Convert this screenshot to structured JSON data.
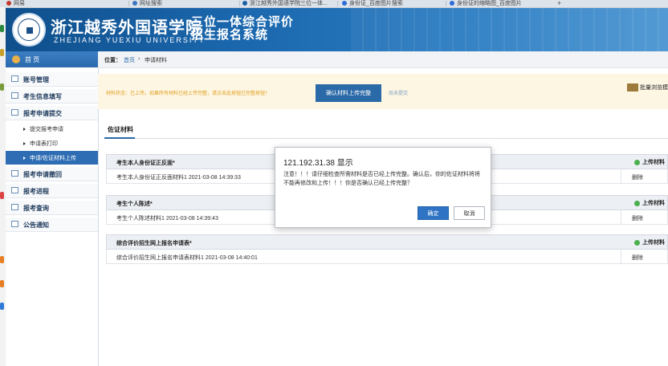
{
  "browser_tabs": [
    {
      "label": "网易",
      "color": "#c0392b"
    },
    {
      "label": "网址搜索",
      "color": "#3b78c2"
    },
    {
      "label": "浙江越秀外国语学院三位一体...",
      "color": "#1b5fa6"
    },
    {
      "label": "身份证_百度图片搜索",
      "color": "#2d6bd6"
    },
    {
      "label": "身份证的缩略图_百度图片",
      "color": "#2d6bd6"
    }
  ],
  "header": {
    "school_cn": "浙江越秀外国语学院",
    "school_en": "ZHEJIANG YUEXIU UNIVERSITY",
    "title_line1": "三位一体综合评价",
    "title_line2": "招生报名系统"
  },
  "sidebar": {
    "home": "首 页",
    "items": [
      {
        "label": "账号管理"
      },
      {
        "label": "考生信息填写"
      },
      {
        "label": "报考申请提交"
      }
    ],
    "sub_items": [
      {
        "label": "提交报考申请"
      },
      {
        "label": "申请表打印"
      },
      {
        "label": "申请/佐证材料上传",
        "active": true
      }
    ],
    "items2": [
      {
        "label": "报考申请撤回"
      },
      {
        "label": "报考进程"
      },
      {
        "label": "报考查询"
      },
      {
        "label": "公告通知"
      }
    ]
  },
  "breadcrumb": {
    "prefix": "位置：",
    "home": "首页",
    "sep": "›",
    "current": "申请材料"
  },
  "status": {
    "text": "材料状态：已上传。如果所有材料已经上传完整，请点击此按钮已完整按钮！",
    "confirm_button": "确认材料上传完整",
    "cancel_link": "尚未提交",
    "batch_label": "批量浏览模"
  },
  "section": {
    "tab": "佐证材料"
  },
  "materials": [
    {
      "title": "考生本人身份证正反面*",
      "upload": "上传材料",
      "file": "考生本人身份证正反面材料1 2021-03-08 14:39:33",
      "delete": "删除"
    },
    {
      "title": "考生个人陈述*",
      "upload": "上传材料",
      "file": "考生个人陈述材料1 2021-03-08 14:39:43",
      "delete": "删除"
    },
    {
      "title": "综合评价招生网上报名申请表*",
      "upload": "上传材料",
      "file": "综合评价招生网上报名申请表材料1 2021-03-08 14:40:01",
      "delete": "删除"
    }
  ],
  "dialog": {
    "title": "121.192.31.38 显示",
    "message": "注意！！！请仔细检查所需材料是否已经上传完整。确认后，你的佐证材料将将不能再修改和上传！！！你是否确认已经上传完整？",
    "ok": "确定",
    "cancel": "取消"
  }
}
